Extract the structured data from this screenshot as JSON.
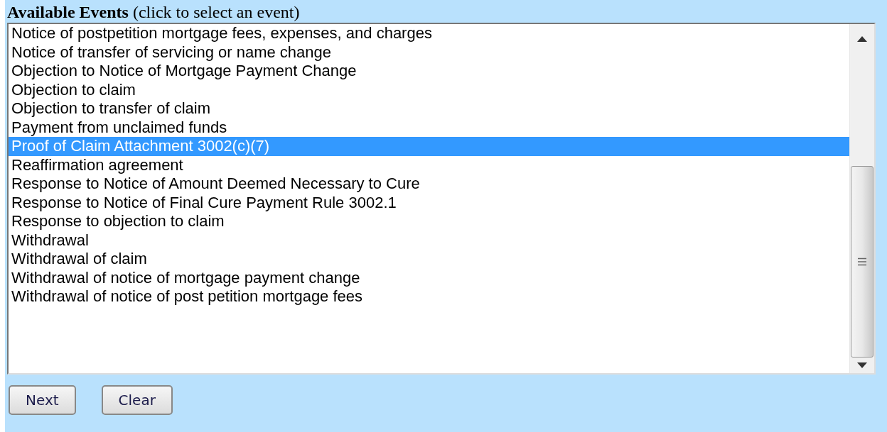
{
  "heading": "**Available Events** (click to select an event)",
  "events": [
    {
      "label": "Notice of postpetition mortgage fees, expenses, and charges",
      "selected": false
    },
    {
      "label": "Notice of transfer of servicing or name change",
      "selected": false
    },
    {
      "label": "Objection to Notice of Mortgage Payment Change",
      "selected": false
    },
    {
      "label": "Objection to claim",
      "selected": false
    },
    {
      "label": "Objection to transfer of claim",
      "selected": false
    },
    {
      "label": "Payment from unclaimed funds",
      "selected": false
    },
    {
      "label": "Proof of Claim Attachment 3002(c)(7)",
      "selected": true
    },
    {
      "label": "Reaffirmation agreement",
      "selected": false
    },
    {
      "label": "Response to Notice of Amount Deemed Necessary to Cure",
      "selected": false
    },
    {
      "label": "Response to Notice of Final Cure Payment Rule 3002.1",
      "selected": false
    },
    {
      "label": "Response to objection to claim",
      "selected": false
    },
    {
      "label": "Withdrawal",
      "selected": false
    },
    {
      "label": "Withdrawal of claim",
      "selected": false
    },
    {
      "label": "Withdrawal of notice of mortgage payment change",
      "selected": false
    },
    {
      "label": "Withdrawal of notice of post petition mortgage fees",
      "selected": false
    }
  ],
  "buttons": [
    "Next",
    "Clear"
  ]
}
